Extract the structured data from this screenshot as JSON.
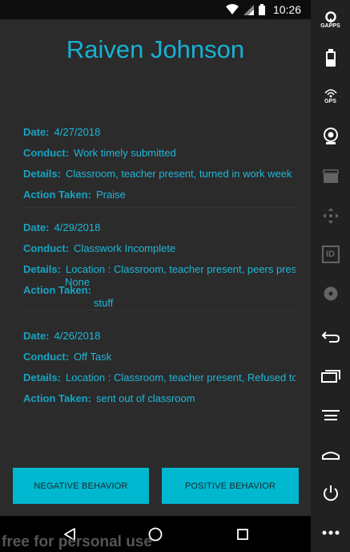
{
  "status_bar": {
    "time": "10:26"
  },
  "app": {
    "title": "Raiven Johnson",
    "records": [
      {
        "date_label": "Date:",
        "date": "4/27/2018",
        "conduct_label": "Conduct:",
        "conduct": "Work timely submitted",
        "details_label": "Details:",
        "details": "Classroom, teacher present, turned in work week",
        "action_label": "Action Taken:",
        "action": "Praise"
      },
      {
        "date_label": "Date:",
        "date": "4/29/2018",
        "conduct_label": "Conduct:",
        "conduct": "Classwork Incomplete",
        "details_label": "Details:",
        "details": "Location : Classroom, teacher present, peers pres",
        "details_overflow": "None",
        "action_label": "Action Taken:",
        "action": "stuff"
      },
      {
        "date_label": "Date:",
        "date": "4/26/2018",
        "conduct_label": "Conduct:",
        "conduct": "Off Task",
        "details_label": "Details:",
        "details": "Location : Classroom, teacher present, Refused to",
        "action_label": "Action Taken:",
        "action": "sent out of classroom"
      }
    ],
    "buttons": {
      "negative": "NEGATIVE BEHAVIOR",
      "positive": "POSITIVE BEHAVIOR"
    },
    "watermark": "free for personal use"
  },
  "side_panel": {
    "gapps_label": "GAPPS",
    "gps_label": "GPS",
    "id_label": "ID"
  },
  "colors": {
    "accent": "#18b1d4",
    "button": "#00b7d0",
    "background": "#2b2b2b"
  }
}
